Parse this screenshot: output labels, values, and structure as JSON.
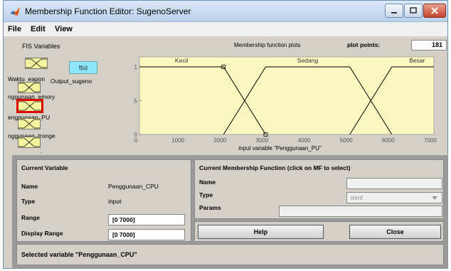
{
  "window": {
    "title": "Membership Function Editor: SugenoServer"
  },
  "menu": [
    "File",
    "Edit",
    "View"
  ],
  "fis": {
    "label": "FIS Variables",
    "output_box": "f(u)",
    "inputs": [
      "Waktu_eapon",
      "nggunaan_emory",
      "enggunaan_PU",
      "nggunaan_tronge",
      "ggunaan_ariana"
    ],
    "output_name": "Output_sugeno"
  },
  "plot": {
    "title": "Membership function plots",
    "plot_points_label": "plot points:",
    "plot_points_value": "181"
  },
  "chart_data": {
    "type": "line",
    "title": "",
    "xlabel": "input variable \"Penggunaan_PU\"",
    "ylabel": "",
    "xlim": [
      0,
      7000
    ],
    "ylim": [
      0,
      1
    ],
    "xticks": [
      "0",
      "1000",
      "2000",
      "3000",
      "4000",
      "5000",
      "6000",
      "7000"
    ],
    "yticks": [
      "0",
      "0.5",
      "1"
    ],
    "series": [
      {
        "name": "Kecil",
        "x": [
          0,
          2000,
          3000
        ],
        "y": [
          1,
          1,
          0
        ]
      },
      {
        "name": "Sedang",
        "x": [
          2000,
          3000,
          5000,
          6000
        ],
        "y": [
          0,
          1,
          1,
          0
        ]
      },
      {
        "name": "Besar",
        "x": [
          5000,
          6000,
          7000
        ],
        "y": [
          0,
          1,
          1
        ]
      }
    ],
    "grid": false
  },
  "current_variable": {
    "header": "Current Variable",
    "name_label": "Name",
    "name_value": "Penggunaan_CPU",
    "type_label": "Type",
    "type_value": "input",
    "range_label": "Range",
    "range_value": "[0 7000]",
    "display_range_label": "Display Range",
    "display_range_value": "[0 7000]"
  },
  "current_mf": {
    "header": "Current Membership Function (click on MF to select)",
    "name_label": "Name",
    "name_value": "",
    "type_label": "Type",
    "type_value": "trimf",
    "params_label": "Params",
    "params_value": ""
  },
  "buttons": {
    "help": "Help",
    "close": "Close"
  },
  "status": "Selected variable \"Penggunaan_CPU\""
}
